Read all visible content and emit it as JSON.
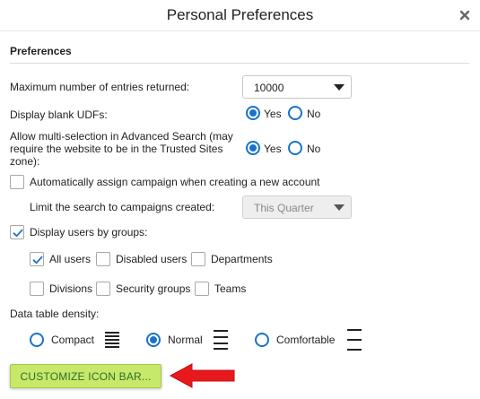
{
  "window": {
    "title": "Personal Preferences"
  },
  "preferences": {
    "section_title": "Preferences",
    "max_entries": {
      "label": "Maximum number of entries returned:",
      "value": "10000"
    },
    "blank_udfs": {
      "label": "Display blank UDFs:",
      "yes": "Yes",
      "no": "No",
      "selected": "Yes"
    },
    "multi_selection": {
      "label_line1": "Allow multi-selection in Advanced Search (may",
      "label_line2": "require the website to be in the Trusted Sites",
      "label_line3": "zone):",
      "yes": "Yes",
      "no": "No",
      "selected": "Yes"
    },
    "auto_campaign": {
      "label": "Automatically assign campaign when creating a new account",
      "checked": false
    },
    "limit_search": {
      "label": "Limit the search to campaigns created:",
      "value": "This Quarter",
      "disabled": true
    },
    "users_by_groups": {
      "label": "Display users by groups:",
      "checked": true,
      "options": [
        {
          "label": "All users",
          "checked": true
        },
        {
          "label": "Disabled users",
          "checked": false
        },
        {
          "label": "Departments",
          "checked": false
        },
        {
          "label": "Divisions",
          "checked": false
        },
        {
          "label": "Security groups",
          "checked": false
        },
        {
          "label": "Teams",
          "checked": false
        }
      ]
    },
    "density": {
      "label": "Data table density:",
      "options": [
        {
          "label": "Compact",
          "icon": "density-compact-icon"
        },
        {
          "label": "Normal",
          "icon": "density-normal-icon"
        },
        {
          "label": "Comfortable",
          "icon": "density-comfortable-icon"
        }
      ],
      "selected": "Normal"
    },
    "customize_button": "CUSTOMIZE ICON BAR..."
  },
  "colors": {
    "accent": "#1a73c8",
    "button_bg": "#c8e86a",
    "button_text": "#2c6f2c",
    "arrow": "#e8191c"
  }
}
